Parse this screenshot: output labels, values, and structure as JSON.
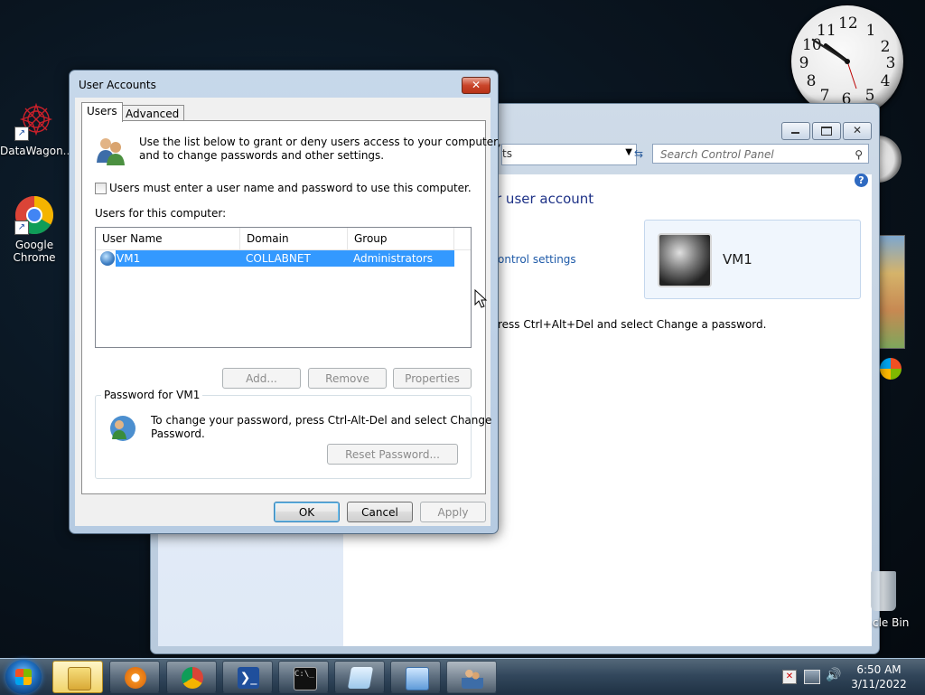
{
  "desktop": {
    "icons": [
      {
        "label": "DataWagon..."
      },
      {
        "label": "Google Chrome"
      }
    ],
    "recycle_bin_label": "cle Bin",
    "clock_numbers": [
      "12",
      "1",
      "2",
      "3",
      "4",
      "5",
      "6",
      "7",
      "8",
      "9",
      "10",
      "11"
    ]
  },
  "control_panel": {
    "address_fragment": "ts",
    "search_placeholder": "Search Control Panel",
    "heading_fragment": "r user account",
    "link_fragment": "ontrol settings",
    "note_fragment": "ress Ctrl+Alt+Del and select Change a password.",
    "user_card_name": "VM1"
  },
  "dialog": {
    "title": "User Accounts",
    "close_glyph": "✕",
    "tabs": [
      {
        "label": "Users",
        "selected": true
      },
      {
        "label": "Advanced",
        "selected": false
      }
    ],
    "intro_text_1": "Use the list below to grant or deny users access to your computer,",
    "intro_text_2": "and to change passwords and other settings.",
    "must_login_label": "Users must enter a user name and password to use this computer.",
    "must_login_checked": false,
    "users_list_label": "Users for this computer:",
    "columns": [
      "User Name",
      "Domain",
      "Group"
    ],
    "rows": [
      {
        "user": "VM1",
        "domain": "COLLABNET",
        "group": "Administrators",
        "selected": true
      }
    ],
    "buttons": {
      "add": "Add...",
      "remove": "Remove",
      "properties": "Properties",
      "reset_password": "Reset Password...",
      "ok": "OK",
      "cancel": "Cancel",
      "apply": "Apply"
    },
    "password_group_title": "Password for VM1",
    "password_text_1": "To change your password, press Ctrl-Alt-Del and select Change",
    "password_text_2": "Password."
  },
  "taskbar": {
    "time": "6:50 AM",
    "date": "3/11/2022"
  }
}
